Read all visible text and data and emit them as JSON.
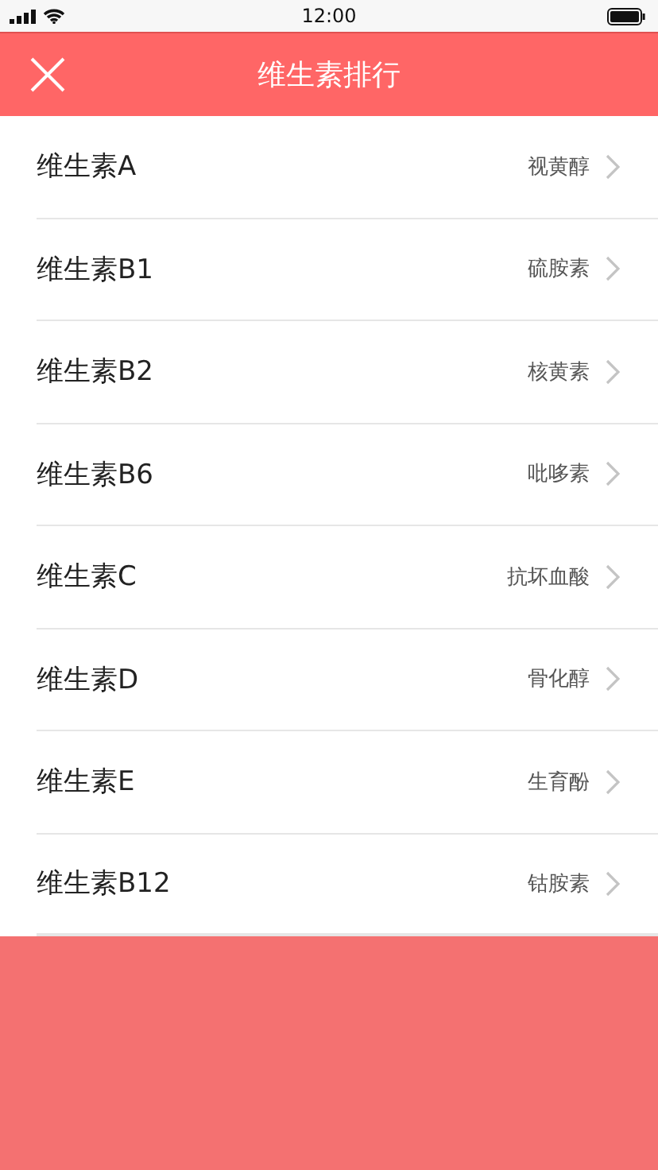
{
  "status_bar": {
    "time": "12:00"
  },
  "header": {
    "title": "维生素排行"
  },
  "items": [
    {
      "name": "维生素A",
      "detail": "视黄醇"
    },
    {
      "name": "维生素B1",
      "detail": "硫胺素"
    },
    {
      "name": "维生素B2",
      "detail": "核黄素"
    },
    {
      "name": "维生素B6",
      "detail": "吡哆素"
    },
    {
      "name": "维生素C",
      "detail": "抗坏血酸"
    },
    {
      "name": "维生素D",
      "detail": "骨化醇"
    },
    {
      "name": "维生素E",
      "detail": "生育酚"
    },
    {
      "name": "维生素B12",
      "detail": "钴胺素"
    }
  ]
}
